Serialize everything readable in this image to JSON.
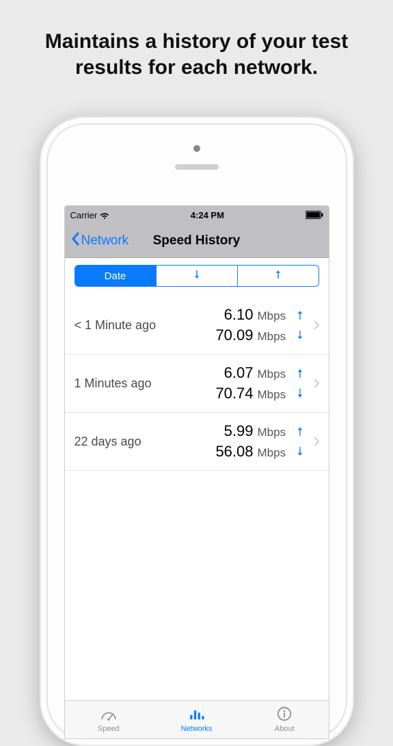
{
  "promo": {
    "line": "Maintains a history of your test results for each network."
  },
  "status": {
    "carrier": "Carrier",
    "time": "4:24 PM"
  },
  "nav": {
    "back_label": "Network",
    "title": "Speed History"
  },
  "segmented": {
    "date_label": "Date"
  },
  "history": [
    {
      "time": "< 1 Minute ago",
      "up_value": "6.10",
      "up_unit": "Mbps",
      "down_value": "70.09",
      "down_unit": "Mbps"
    },
    {
      "time": "1 Minutes ago",
      "up_value": "6.07",
      "up_unit": "Mbps",
      "down_value": "70.74",
      "down_unit": "Mbps"
    },
    {
      "time": "22 days ago",
      "up_value": "5.99",
      "up_unit": "Mbps",
      "down_value": "56.08",
      "down_unit": "Mbps"
    }
  ],
  "tabs": {
    "speed": "Speed",
    "networks": "Networks",
    "about": "About"
  },
  "colors": {
    "accent": "#0a7aff"
  }
}
